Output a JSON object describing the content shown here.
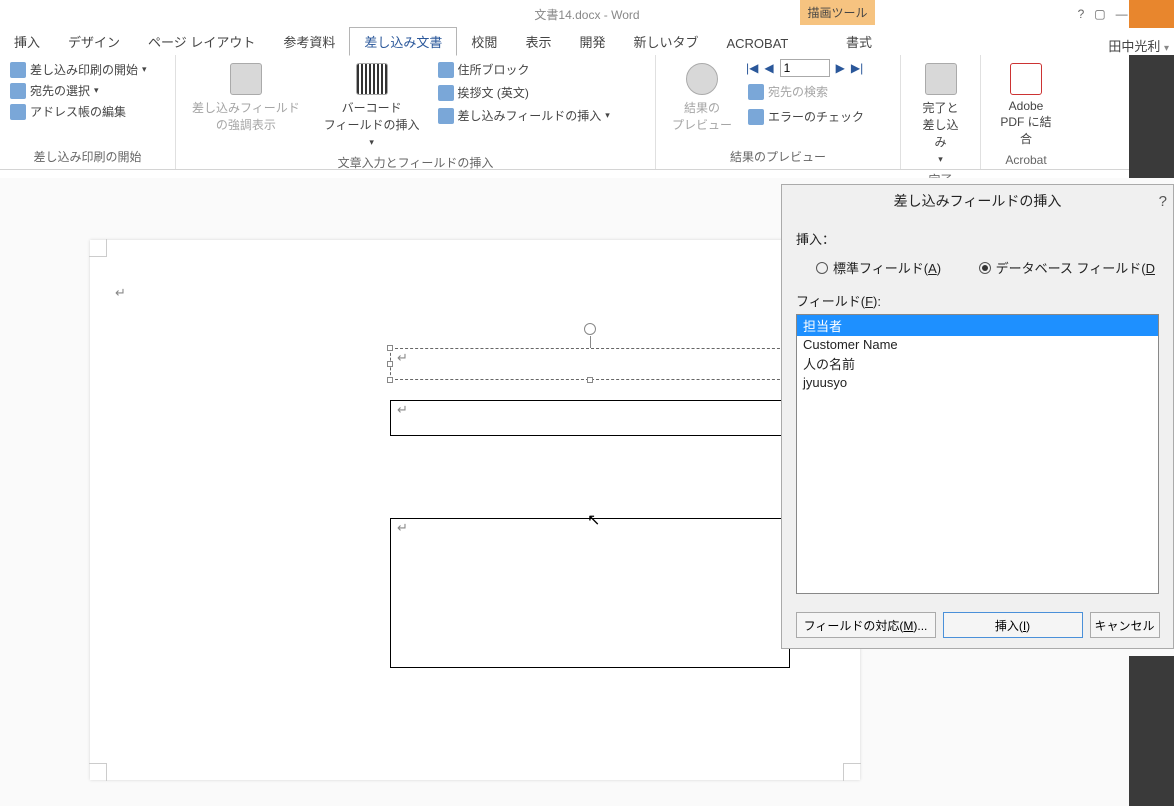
{
  "app": {
    "titleSuffix": "文書14.docx - Word",
    "contextTool": "描画ツール",
    "formatTab": "書式",
    "user": "田中光利"
  },
  "wincontrols": {
    "help": "?",
    "opts": "▢",
    "min": "—",
    "restore": "▭",
    "close": "✕"
  },
  "tabs": {
    "items": [
      "挿入",
      "デザイン",
      "ページ レイアウト",
      "参考資料",
      "差し込み文書",
      "校閲",
      "表示",
      "開発",
      "新しいタブ",
      "ACROBAT"
    ],
    "activeIndex": 4
  },
  "ribbon": {
    "g1": {
      "label": "差し込み印刷の開始",
      "startMailMerge": "差し込み印刷の開始",
      "selectRecipients": "宛先の選択",
      "editRecipientList": "アドレス帳の編集"
    },
    "g2": {
      "label": "文章入力とフィールドの挿入",
      "highlightMergeFields": "差し込みフィールド\nの強調表示",
      "barcode": "バーコード\nフィールドの挿入",
      "addressBlock": "住所ブロック",
      "greetingLine": "挨拶文 (英文)",
      "insertMergeField": "差し込みフィールドの挿入"
    },
    "g3": {
      "label": "結果のプレビュー",
      "previewResults": "結果の\nプレビュー",
      "findRecipient": "宛先の検索",
      "checkErrors": "エラーのチェック",
      "recordValue": "1"
    },
    "g4": {
      "label": "完了",
      "finishMerge": "完了と\n差し込み"
    },
    "g5": {
      "label": "Acrobat",
      "mergeToPdf": "Adobe\nPDF に結合"
    }
  },
  "document": {
    "textbox1_content": "↵",
    "textbox2_content": "↵",
    "textbox3_content": "↵"
  },
  "dialog": {
    "title": "差し込みフィールドの挿入",
    "help": "?",
    "insertLabel": "挿入：",
    "radioAddress": "標準フィールド(",
    "radioAddressKey": "A",
    "radioDatabase": "データベース フィールド(",
    "radioDatabaseKey": "D",
    "fieldsLabel": "フィールド(",
    "fieldsKey": "F",
    "fieldsClose": "):",
    "fields": [
      "担当者",
      "Customer Name",
      "人の名前",
      "jyuusyo"
    ],
    "selectedIndex": 0,
    "btnMatch": "フィールドの対応(",
    "btnMatchKey": "M",
    "btnMatchClose": ")...",
    "btnInsert": "挿入(",
    "btnInsertKey": "I",
    "btnInsertClose": ")",
    "btnCancel": "キャンセル"
  }
}
